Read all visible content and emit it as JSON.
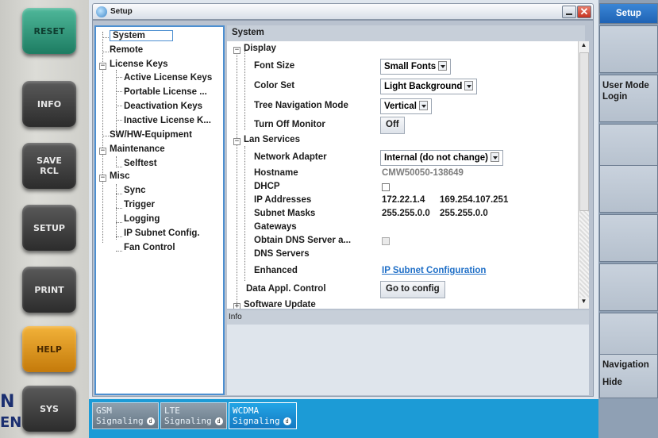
{
  "hardware_keys": [
    "RESET",
    "INFO",
    "SAVE\nRCL",
    "SETUP",
    "PRINT",
    "HELP",
    "SYS"
  ],
  "edge_text": [
    "N",
    "EN"
  ],
  "window": {
    "title": "Setup"
  },
  "tree": {
    "items": [
      {
        "label": "System",
        "selected": true
      },
      {
        "label": "Remote"
      },
      {
        "label": "License Keys",
        "expander": "−"
      },
      {
        "label": "Active License Keys"
      },
      {
        "label": "Portable License ..."
      },
      {
        "label": "Deactivation Keys"
      },
      {
        "label": "Inactive License K..."
      },
      {
        "label": "SW/HW-Equipment"
      },
      {
        "label": "Maintenance",
        "expander": "−"
      },
      {
        "label": "Selftest"
      },
      {
        "label": "Misc",
        "expander": "−"
      },
      {
        "label": "Sync"
      },
      {
        "label": "Trigger"
      },
      {
        "label": "Logging"
      },
      {
        "label": "IP Subnet Config."
      },
      {
        "label": "Fan Control"
      }
    ]
  },
  "panel": {
    "heading": "System",
    "display": {
      "label": "Display",
      "font_size_label": "Font Size",
      "font_size_value": "Small Fonts",
      "color_set_label": "Color Set",
      "color_set_value": "Light Background",
      "tree_nav_label": "Tree Navigation Mode",
      "tree_nav_value": "Vertical",
      "turn_off_label": "Turn Off Monitor",
      "turn_off_button": "Off"
    },
    "lan": {
      "label": "Lan Services",
      "adapter_label": "Network Adapter",
      "adapter_value": "Internal (do not change)",
      "hostname_label": "Hostname",
      "hostname_value": "CMW50050-138649",
      "dhcp_label": "DHCP",
      "ip_label": "IP Addresses",
      "ip_value_1": "172.22.1.4",
      "ip_value_2": "169.254.107.251",
      "mask_label": "Subnet Masks",
      "mask_value_1": "255.255.0.0",
      "mask_value_2": "255.255.0.0",
      "gateways_label": "Gateways",
      "obtain_dns_label": "Obtain DNS Server a...",
      "dns_label": "DNS Servers",
      "enhanced_label": "Enhanced",
      "enhanced_link": "IP Subnet Configuration"
    },
    "data_appl_label": "Data Appl. Control",
    "data_appl_button": "Go to config",
    "software_update_label": "Software Update"
  },
  "info": {
    "label": "Info"
  },
  "softkeys": {
    "top": "Setup",
    "user_mode_1": "User Mode",
    "user_mode_2": "Login",
    "navigation_1": "Navigation",
    "navigation_2": "Hide"
  },
  "bottom_tabs": [
    {
      "line1": "GSM",
      "line2": "Signaling",
      "badge": "d"
    },
    {
      "line1": "LTE",
      "line2": "Signaling",
      "badge": "d"
    },
    {
      "line1": "WCDMA",
      "line2": "Signaling",
      "badge": "d",
      "active": true
    }
  ],
  "colors": {
    "accent": "#1c9bd6",
    "selection_border": "#4d8fd0",
    "link": "#1f6fc7"
  }
}
